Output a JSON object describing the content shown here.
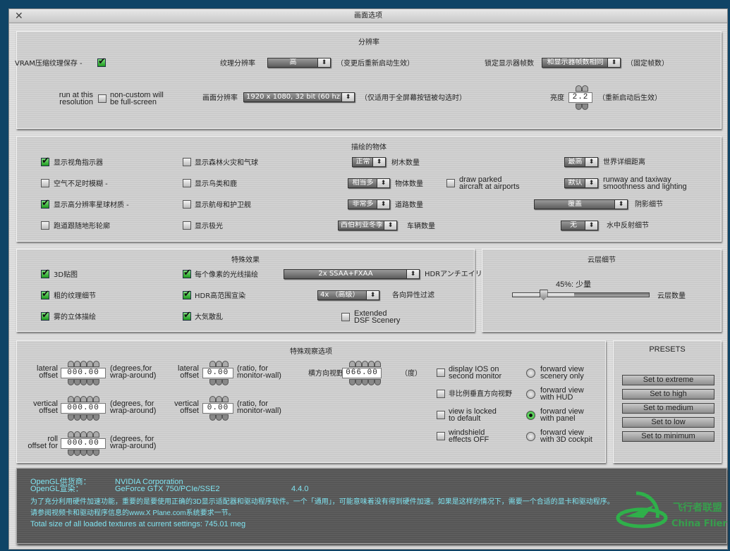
{
  "window": {
    "title": "画面选项",
    "close_icon": "close-x-icon"
  },
  "resolution": {
    "title": "分辨率",
    "vram_label": "VRAM压缩纹理保存 -",
    "vram_checked": true,
    "texture_label": "纹理分辨率",
    "texture_value": "高",
    "texture_note": "（变更后重新启动生效）",
    "lock_fps_label": "锁定显示器帧数",
    "lock_fps_value": "和显示器帧数相同",
    "lock_fps_note": "（固定帧数）",
    "run_at_res_line1": "run at this",
    "run_at_res_line2": "resolution",
    "run_at_res_checked": false,
    "noncustom_line1": "non-custom will",
    "noncustom_line2": "be full-screen",
    "screen_res_label": "画面分辨率",
    "screen_res_value": "1920 x 1080, 32 bit (60 hz)",
    "screen_res_note": "（仅适用于全屏幕按钮被勾选时）",
    "brightness_label": "亮度",
    "brightness_value": "2.2",
    "brightness_note": "（重新启动后生效）"
  },
  "objects": {
    "title": "描绘的物体",
    "col1": [
      {
        "label": "显示视角指示器",
        "checked": true
      },
      {
        "label": "空气不足时模糊 -",
        "checked": false
      },
      {
        "label": "显示高分辨率星球材质 -",
        "checked": true
      },
      {
        "label": "跑道跟随地形轮廓",
        "checked": false
      }
    ],
    "col2": [
      {
        "label": "显示森林火灾和气球",
        "checked": false
      },
      {
        "label": "显示鸟类和鹿",
        "checked": false
      },
      {
        "label": "显示航母和护卫舰",
        "checked": false
      },
      {
        "label": "显示极光",
        "checked": false
      }
    ],
    "selects": [
      {
        "value": "正常",
        "label": "树木数量"
      },
      {
        "value": "相当多",
        "label": "物体数量"
      },
      {
        "value": "非常多",
        "label": "道路数量"
      },
      {
        "value": "西伯利亚冬季",
        "label": "车辆数量"
      }
    ],
    "parked_line1": "draw parked",
    "parked_line2": "aircraft at airports",
    "parked_checked": false,
    "world_detail": {
      "value": "最高",
      "label": "世界详细距离"
    },
    "runway": {
      "value": "默认",
      "line1": "runway and taxiway",
      "line2": "smoothness and lighting"
    },
    "shadow": {
      "value": "覆盖",
      "label": "阴影细节"
    },
    "water": {
      "value": "无",
      "label": "水中反射细节"
    }
  },
  "effects": {
    "title": "特殊效果",
    "col1": [
      {
        "label": "3D贴图",
        "checked": true
      },
      {
        "label": "粗的纹理细节",
        "checked": true
      },
      {
        "label": "雾的立体描绘",
        "checked": true
      }
    ],
    "col2": [
      {
        "label": "每个像素的光线描绘",
        "checked": true
      },
      {
        "label": "HDR高范围宣染",
        "checked": true
      },
      {
        "label": "大気散乱",
        "checked": true
      }
    ],
    "aa_value": "2x SSAA+FXAA",
    "aa_label": "HDRアンチエイリアス",
    "aniso_value": "4x  （高级）",
    "aniso_label": "各向异性过滤",
    "dsf_line1": "Extended",
    "dsf_line2": "DSF Scenery",
    "dsf_checked": false
  },
  "clouds": {
    "title": "云层细节",
    "value_text": "45%: 少量",
    "percent": 45,
    "label": "云层数量"
  },
  "views": {
    "title": "特殊观察选项",
    "deg_rows": [
      {
        "l1": "lateral",
        "l2": "offset",
        "value": "000.00",
        "n1": "(degrees,for",
        "n2": "wrap-around)"
      },
      {
        "l1": "vertical",
        "l2": "offset",
        "value": "000.00",
        "n1": "(degrees, for",
        "n2": "wrap-around)"
      },
      {
        "l1": "roll",
        "l2": "offset for",
        "value": "000.00",
        "n1": "(degrees, for",
        "n2": "wrap-around)"
      }
    ],
    "ratio_rows": [
      {
        "l1": "lateral",
        "l2": "offset",
        "value": "0.00",
        "n1": "(ratio, for",
        "n2": "monitor-wall)"
      },
      {
        "l1": "vertical",
        "l2": "offset",
        "value": "0.00",
        "n1": "(ratio, for",
        "n2": "monitor-wall)"
      }
    ],
    "fov_label": "横方向视野",
    "fov_value": "066.00",
    "fov_unit": "（度）",
    "checks": [
      {
        "l1": "display IOS on",
        "l2": "second monitor",
        "checked": false
      },
      {
        "l1": "非比例垂直方向视野",
        "l2": "",
        "checked": false
      },
      {
        "l1": "view is locked",
        "l2": "to default",
        "checked": false
      },
      {
        "l1": "windshield",
        "l2": "effects OFF",
        "checked": false
      }
    ],
    "radios": [
      {
        "l1": "forward view",
        "l2": "scenery only",
        "selected": false
      },
      {
        "l1": "forward view",
        "l2": "with HUD",
        "selected": false
      },
      {
        "l1": "forward view",
        "l2": "with panel",
        "selected": true
      },
      {
        "l1": "forward view",
        "l2": "with 3D cockpit",
        "selected": false
      }
    ]
  },
  "presets": {
    "title": "PRESETS",
    "buttons": [
      "Set to extreme",
      "Set to high",
      "Set to medium",
      "Set to low",
      "Set to minimum"
    ]
  },
  "info": {
    "vendor_label": "OpenGL供货商：",
    "vendor_value": "NVIDIA Corporation",
    "renderer_label": "OpenGL宣染：",
    "renderer_value": "GeForce GTX 750/PCIe/SSE2",
    "version": "4.4.0",
    "note1": "为了充分利用硬件加速功能，重要的是要使用正确的3D显示适配器和驱动程序软件。一个「通用」，可能意味着没有得到硬件加速。如果是这样的情况下，需要一个合适的显卡和驱动程序。",
    "note2": "请参阅视频卡和驱动程序信息的www.X Plane.com系统要求一节。",
    "textures": "Total size of all loaded textures at current settings: 745.01 meg"
  },
  "watermark": {
    "text_cn": "飞行者联盟",
    "text_en": "China Flier",
    "color": "#2fb04a"
  },
  "colors": {
    "check_green": "#2fae2f",
    "info_text": "#7fe3f0",
    "background": "#0f4466"
  }
}
